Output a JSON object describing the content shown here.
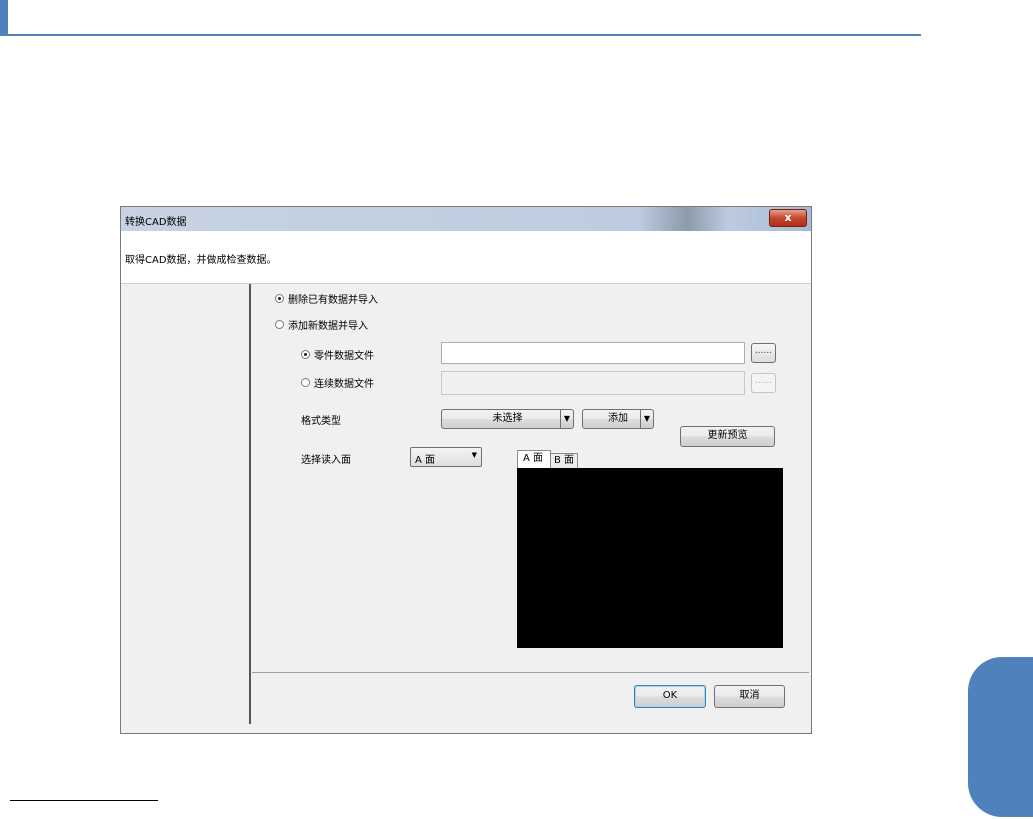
{
  "dialog": {
    "title": "转换CAD数据",
    "close_label": "x",
    "description": "取得CAD数据，并做成检查数据。"
  },
  "import_mode": {
    "options": [
      {
        "label": "删除已有数据并导入",
        "selected": true
      },
      {
        "label": "添加新数据并导入",
        "selected": false
      }
    ]
  },
  "file_source": {
    "options": [
      {
        "label": "零件数据文件",
        "selected": true
      },
      {
        "label": "连续数据文件",
        "selected": false
      }
    ],
    "part_file_value": "",
    "continuous_file_value": "",
    "browse_label": "......"
  },
  "format": {
    "label": "格式类型",
    "selected": "未选择",
    "add_label": "添加",
    "arrow": "▼",
    "update_preview_label": "更新预览"
  },
  "surface": {
    "label": "选择读入面",
    "selected": "A 面",
    "arrow": "▼",
    "tabs": [
      {
        "label": "A 面",
        "active": true
      },
      {
        "label": "B 面",
        "active": false
      }
    ]
  },
  "footer": {
    "ok_label": "OK",
    "cancel_label": "取消"
  },
  "colors": {
    "accent": "#4f81bd",
    "preview_background": "#000000"
  }
}
